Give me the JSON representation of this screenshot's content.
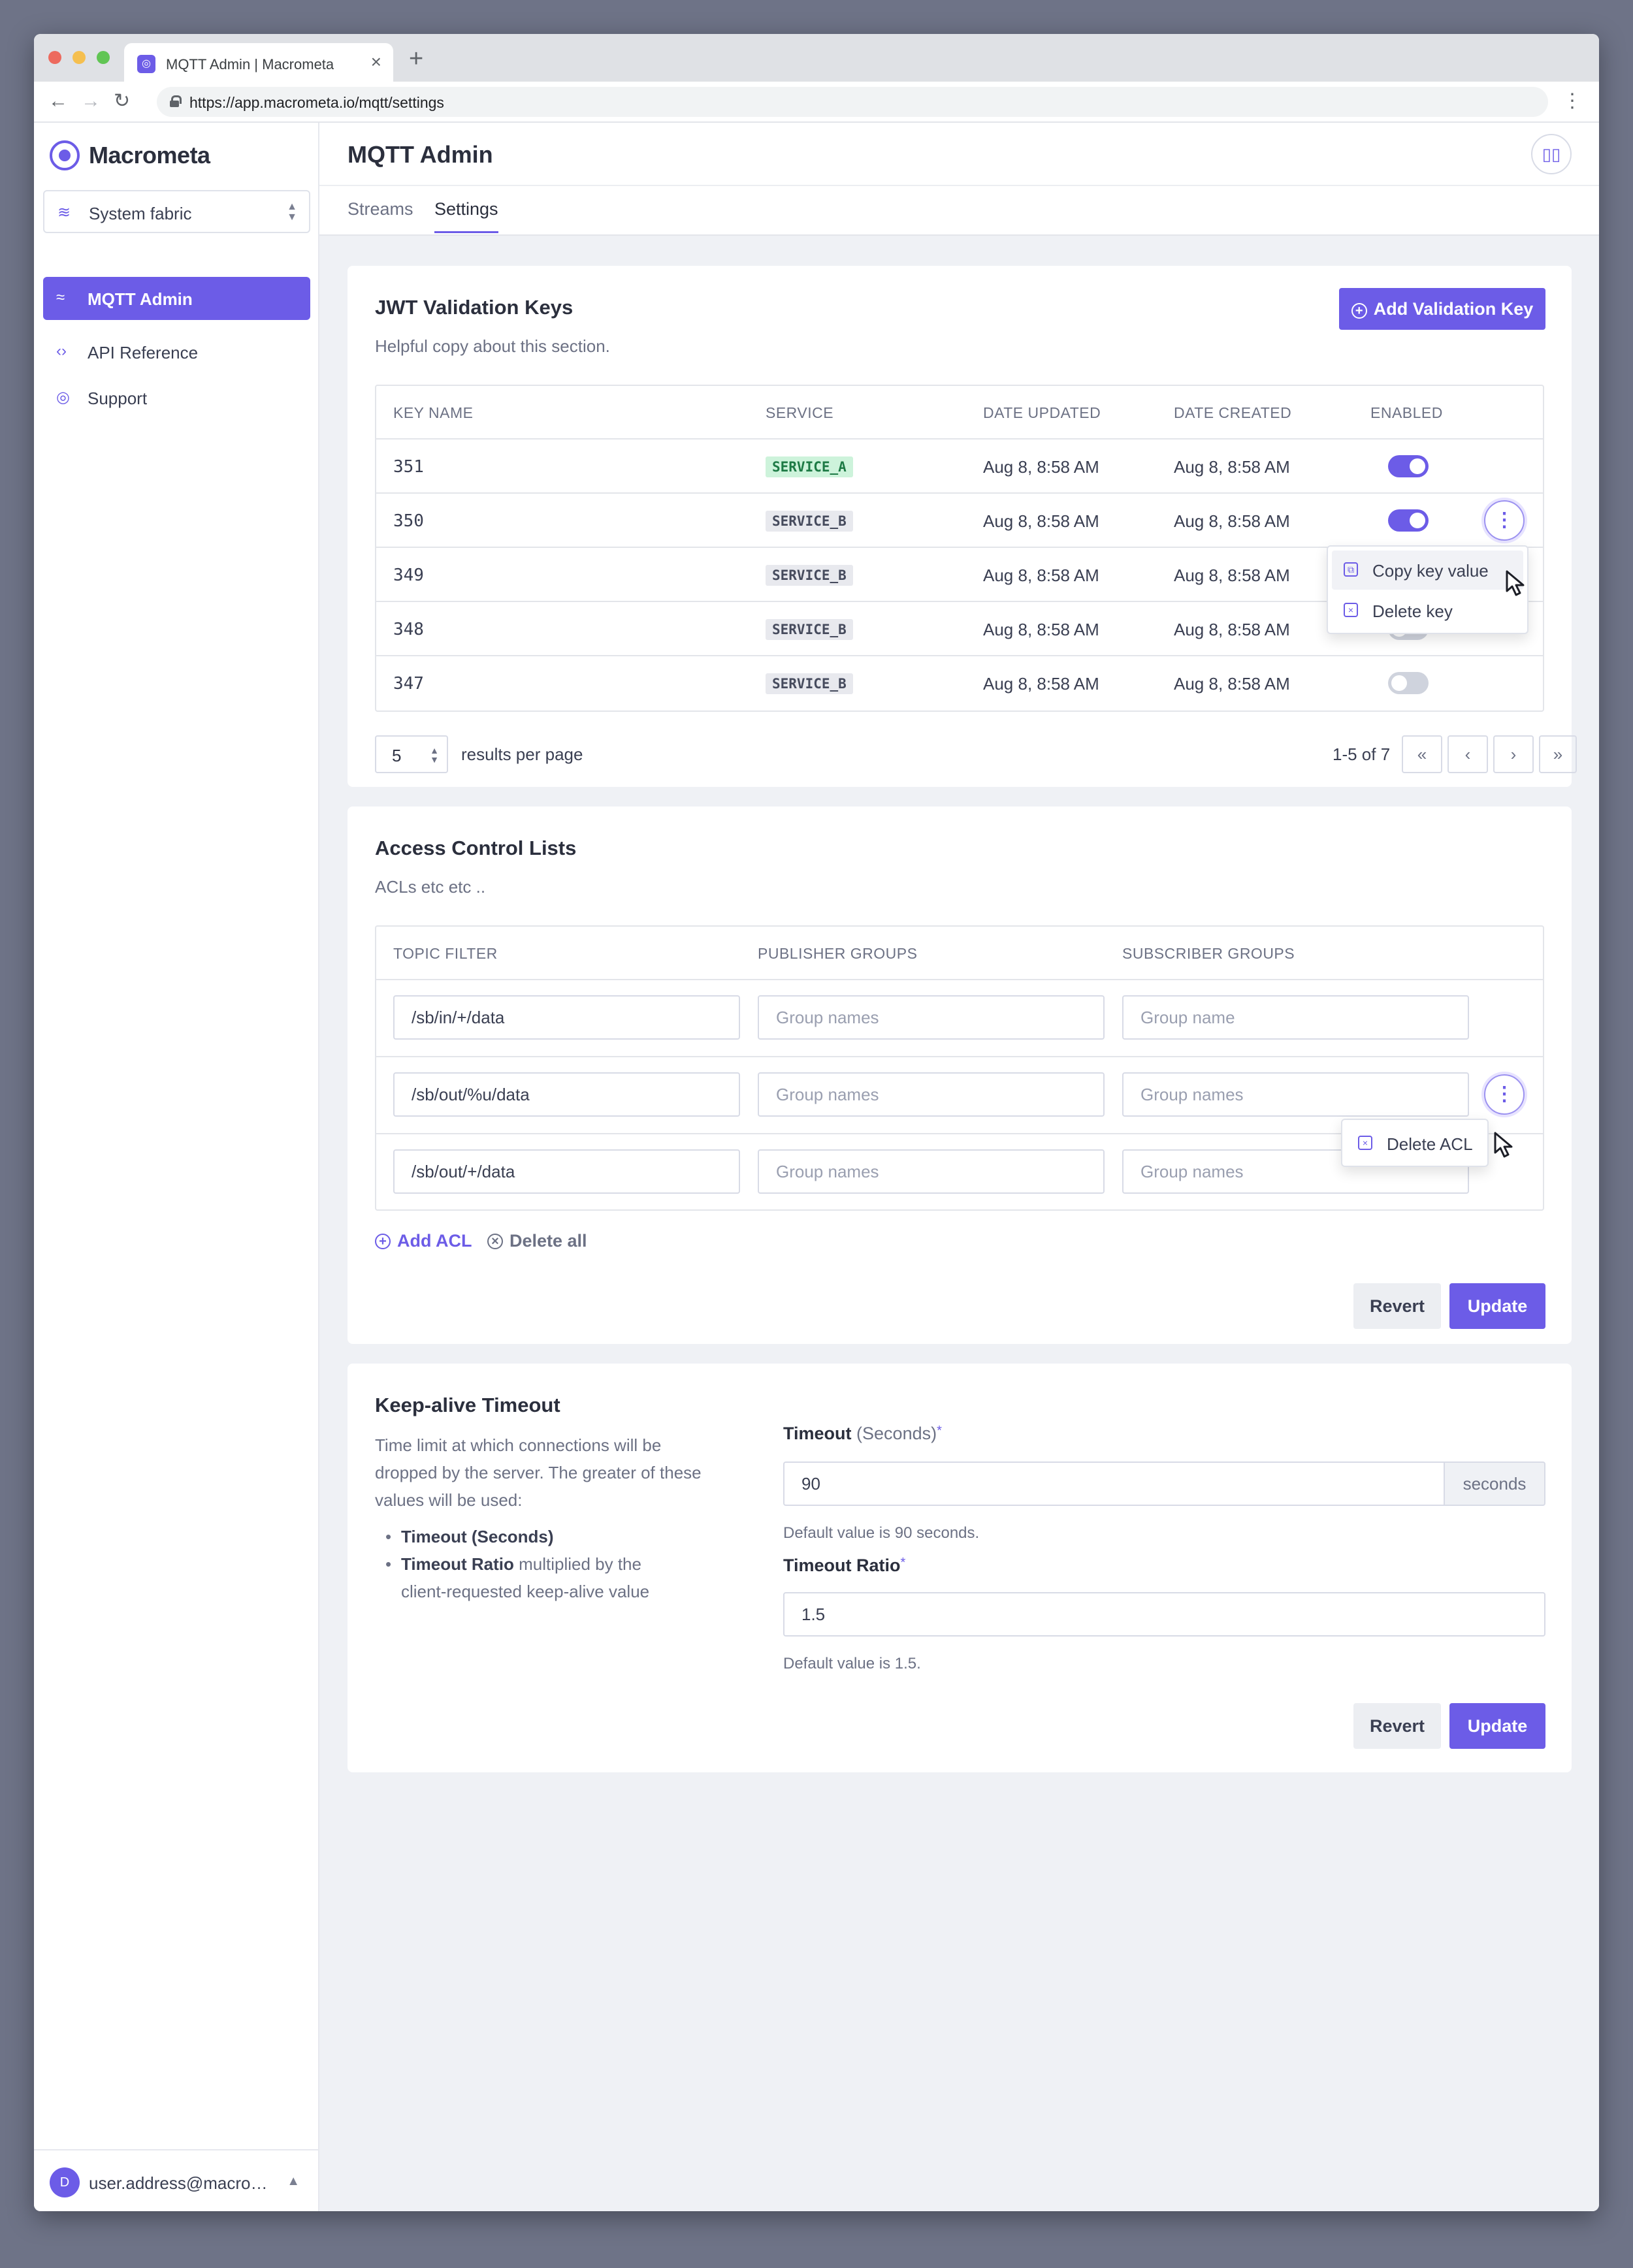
{
  "browser": {
    "tab_title": "MQTT Admin | Macrometa",
    "tab_close": "×",
    "new_tab": "+",
    "url": "https://app.macrometa.io/mqtt/settings"
  },
  "sidebar": {
    "brand": "Macrometa",
    "fabric_select": "System fabric",
    "items": [
      {
        "label": "MQTT Admin",
        "icon": "waves-icon",
        "active": true
      },
      {
        "label": "API Reference",
        "icon": "code-icon",
        "active": false
      },
      {
        "label": "Support",
        "icon": "lifebuoy-icon",
        "active": false
      }
    ],
    "user": {
      "initial": "D",
      "email": "user.address@macro…"
    }
  },
  "header": {
    "title": "MQTT Admin",
    "tabs": [
      {
        "label": "Streams",
        "active": false
      },
      {
        "label": "Settings",
        "active": true
      }
    ]
  },
  "jwt": {
    "title": "JWT Validation Keys",
    "subtitle": "Helpful copy about this section.",
    "add_button": "Add Validation Key",
    "columns": [
      "KEY NAME",
      "SERVICE",
      "DATE UPDATED",
      "DATE CREATED",
      "ENABLED"
    ],
    "rows": [
      {
        "key": "351",
        "service": "SERVICE_A",
        "updated": "Aug 8, 8:58 AM",
        "created": "Aug 8, 8:58 AM",
        "enabled": true
      },
      {
        "key": "350",
        "service": "SERVICE_B",
        "updated": "Aug 8, 8:58 AM",
        "created": "Aug 8, 8:58 AM",
        "enabled": true
      },
      {
        "key": "349",
        "service": "SERVICE_B",
        "updated": "Aug 8, 8:58 AM",
        "created": "Aug 8, 8:58 AM",
        "enabled": false
      },
      {
        "key": "348",
        "service": "SERVICE_B",
        "updated": "Aug 8, 8:58 AM",
        "created": "Aug 8, 8:58 AM",
        "enabled": false
      },
      {
        "key": "347",
        "service": "SERVICE_B",
        "updated": "Aug 8, 8:58 AM",
        "created": "Aug 8, 8:58 AM",
        "enabled": false
      }
    ],
    "menu": {
      "copy": "Copy key value",
      "delete": "Delete key"
    },
    "page_size": "5",
    "per_page_label": "results per page",
    "range": "1-5 of 7",
    "pager": {
      "first": "«",
      "prev": "‹",
      "next": "›",
      "last": "»"
    }
  },
  "acl": {
    "title": "Access Control Lists",
    "subtitle": "ACLs etc etc ..",
    "columns": [
      "TOPIC FILTER",
      "PUBLISHER GROUPS",
      "SUBSCRIBER GROUPS"
    ],
    "rows": [
      {
        "topic": "/sb/in/+/data",
        "pub_placeholder": "Group names",
        "sub_placeholder": "Group name"
      },
      {
        "topic": "/sb/out/%u/data",
        "pub_placeholder": "Group names",
        "sub_placeholder": "Group names"
      },
      {
        "topic": "/sb/out/+/data",
        "pub_placeholder": "Group names",
        "sub_placeholder": "Group names"
      }
    ],
    "menu": {
      "delete": "Delete ACL"
    },
    "add": "Add ACL",
    "delete_all": "Delete all",
    "revert": "Revert",
    "update": "Update"
  },
  "keepalive": {
    "title": "Keep-alive Timeout",
    "description": "Time limit at which connections will be dropped by the server. The greater of these values will be used:",
    "bullets": [
      {
        "bold": "Timeout (Seconds)",
        "rest": ""
      },
      {
        "bold": "Timeout Ratio",
        "rest": " multiplied by the client-requested keep-alive value"
      }
    ],
    "timeout_label": "Timeout",
    "timeout_unit_hint": "(Seconds)",
    "required_mark": "*",
    "timeout_value": "90",
    "timeout_addon": "seconds",
    "timeout_help": "Default value is 90 seconds.",
    "ratio_label": "Timeout Ratio",
    "ratio_value": "1.5",
    "ratio_help": "Default value is 1.5.",
    "revert": "Revert",
    "update": "Update"
  },
  "colors": {
    "accent": "#6c5ce7",
    "service_a_bg": "#cdf3db",
    "service_b_bg": "#e8e9ee"
  }
}
